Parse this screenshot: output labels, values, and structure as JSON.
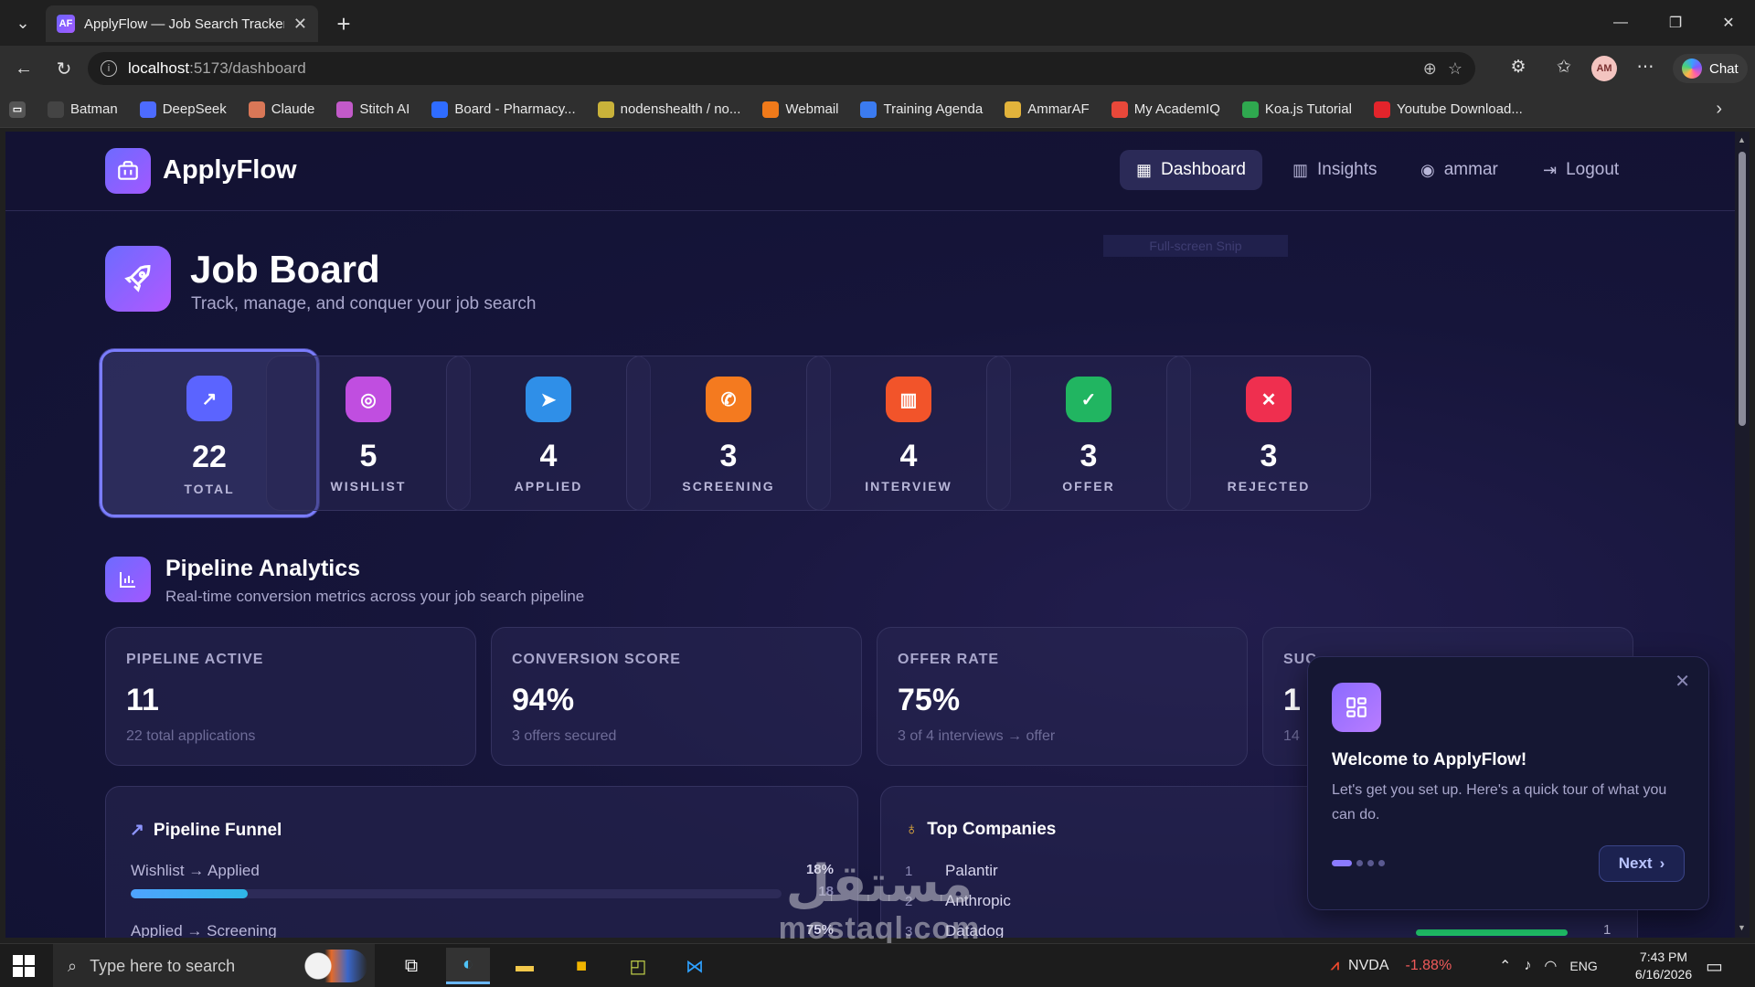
{
  "browser": {
    "tab_title": "ApplyFlow — Job Search Tracker",
    "tab_favicon": "AF",
    "url_host": "localhost",
    "url_rest": ":5173/dashboard",
    "profile_initials": "AM",
    "chat_label": "Chat",
    "bookmarks": [
      {
        "label": "Batman",
        "icon": "ai-icon",
        "color": "#444444"
      },
      {
        "label": "DeepSeek",
        "icon": "whale-icon",
        "color": "#4d6bfe"
      },
      {
        "label": "Claude",
        "icon": "sparkle-icon",
        "color": "#d97757"
      },
      {
        "label": "Stitch AI",
        "icon": "stitch-icon",
        "color": "#c25ac9"
      },
      {
        "label": "Board - Pharmacy...",
        "icon": "board-icon",
        "color": "#2f6cff"
      },
      {
        "label": "nodenshealth / no...",
        "icon": "repo-icon",
        "color": "#c9b23a"
      },
      {
        "label": "Webmail",
        "icon": "mail-icon",
        "color": "#f07a1a"
      },
      {
        "label": "Training Agenda",
        "icon": "doc-icon",
        "color": "#3b7bf0"
      },
      {
        "label": "AmmarAF",
        "icon": "chart-icon",
        "color": "#e2b33b"
      },
      {
        "label": "My AcademIQ",
        "icon": "figma-icon",
        "color": "#e8483a"
      },
      {
        "label": "Koa.js Tutorial",
        "icon": "koa-icon",
        "color": "#2fa84f"
      },
      {
        "label": "Youtube Download...",
        "icon": "youtube-icon",
        "color": "#e3242b"
      }
    ]
  },
  "app": {
    "brand": "ApplyFlow",
    "nav": {
      "dashboard": "Dashboard",
      "insights": "Insights",
      "user": "ammar",
      "logout": "Logout"
    },
    "page_title": "Job Board",
    "page_subtitle": "Track, manage, and conquer your job search",
    "snip_hint": "Full-screen Snip",
    "stats": [
      {
        "value": "22",
        "label": "TOTAL",
        "color": "#5b64ff",
        "icon": "trending-up-icon"
      },
      {
        "value": "5",
        "label": "WISHLIST",
        "color": "#c04ee0",
        "icon": "target-icon"
      },
      {
        "value": "4",
        "label": "APPLIED",
        "color": "#2f8fe8",
        "icon": "send-icon"
      },
      {
        "value": "3",
        "label": "SCREENING",
        "color": "#f47a1f",
        "icon": "phone-icon"
      },
      {
        "value": "4",
        "label": "INTERVIEW",
        "color": "#f2542a",
        "icon": "bar-chart-icon"
      },
      {
        "value": "3",
        "label": "OFFER",
        "color": "#21b561",
        "icon": "check-circle-icon"
      },
      {
        "value": "3",
        "label": "REJECTED",
        "color": "#ef2f4f",
        "icon": "x-circle-icon"
      }
    ],
    "analytics": {
      "title": "Pipeline Analytics",
      "subtitle": "Real-time conversion metrics across your job search pipeline",
      "metrics": [
        {
          "label": "PIPELINE ACTIVE",
          "value": "11",
          "sub": "22 total applications"
        },
        {
          "label": "CONVERSION SCORE",
          "value": "94%",
          "sub": "3 offers secured"
        },
        {
          "label": "OFFER RATE",
          "value": "75%",
          "sub": "3 of 4 interviews → offer"
        },
        {
          "label": "SUC",
          "value": "1",
          "sub": "14"
        }
      ]
    },
    "funnel": {
      "title": "Pipeline Funnel",
      "rows": [
        {
          "label": "Wishlist → Applied",
          "pct": "18%",
          "fill": 0.18
        },
        {
          "label": "Applied → Screening",
          "pct": "75%",
          "fill": 0.75
        }
      ],
      "overlap_text": "18"
    },
    "companies": {
      "title": "Top Companies",
      "rows": [
        {
          "rank": "1",
          "name": "Palantir"
        },
        {
          "rank": "2",
          "name": "Anthropic"
        },
        {
          "rank": "3",
          "name": "Datadog"
        }
      ],
      "row_count": "1"
    },
    "tour": {
      "title": "Welcome to ApplyFlow!",
      "body": "Let's get you set up. Here's a quick tour of what you can do.",
      "next": "Next",
      "step": 1,
      "steps": 4
    }
  },
  "watermark": {
    "arabic": "مستقل",
    "latin": "mostaql.com"
  },
  "taskbar": {
    "search_placeholder": "Type here to search",
    "ticker": "NVDA",
    "ticker_change": "-1.88%",
    "lang": "ENG",
    "time": "7:43 PM",
    "date": "6/16/2026"
  }
}
